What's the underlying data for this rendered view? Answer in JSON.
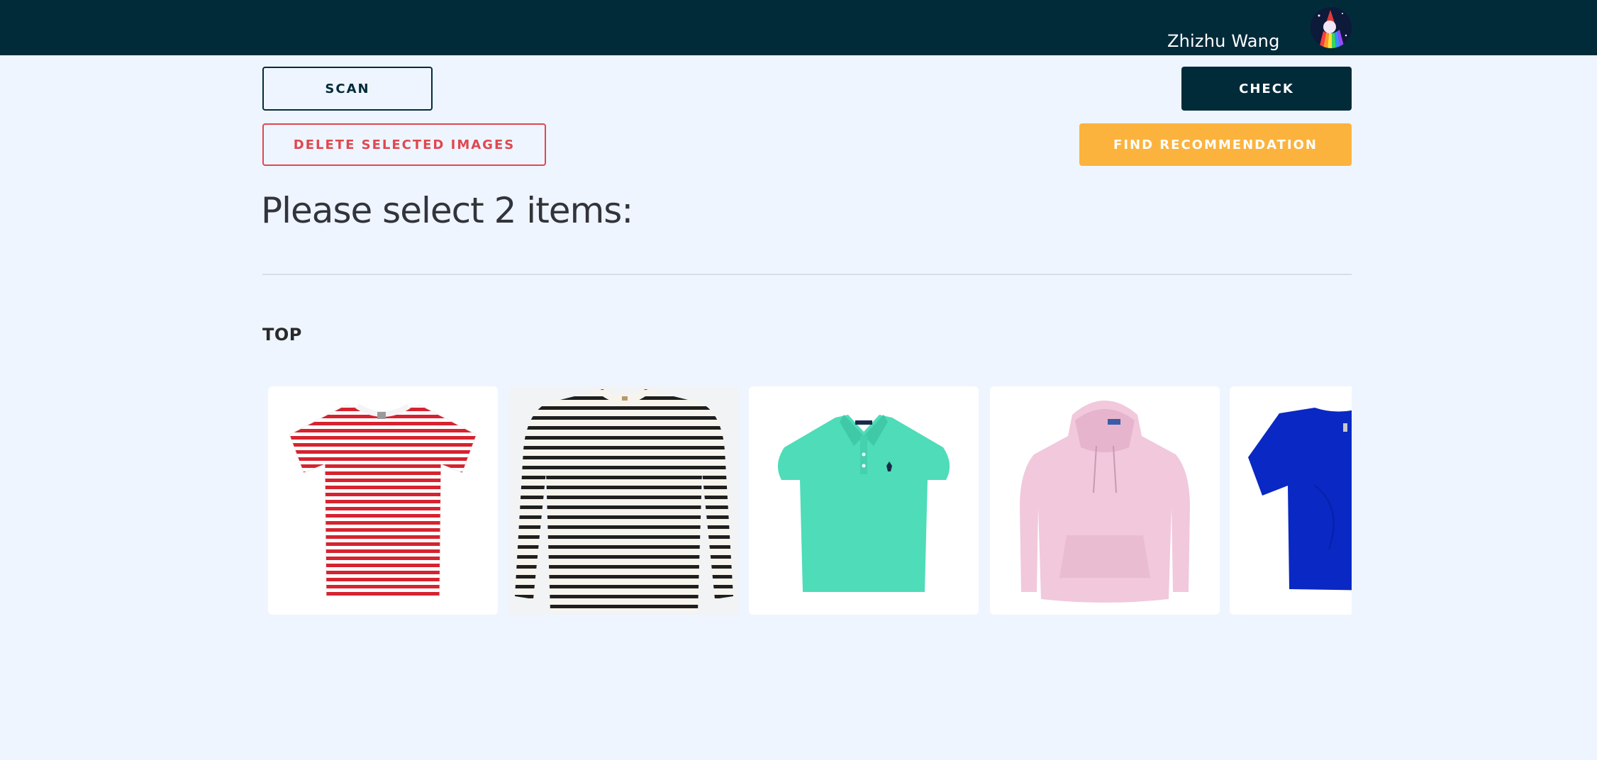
{
  "navbar": {
    "username": "Zhizhu Wang",
    "avatar_icon": "avatar-rainbow-icon"
  },
  "actions": {
    "scan_label": "SCAN",
    "check_label": "CHECK",
    "delete_label": "DELETE SELECTED IMAGES",
    "find_label": "FIND RECOMMENDATION"
  },
  "colors": {
    "navbar": "#022b3a",
    "background": "#eef5fe",
    "danger": "#e0474f",
    "accent": "#fbb33e"
  },
  "main": {
    "heading": "Please select 2 items:",
    "category": "TOP",
    "items": [
      {
        "name": "red-striped-tshirt",
        "color": "#d6232f"
      },
      {
        "name": "black-striped-longsleeve",
        "color": "#1f1f1f"
      },
      {
        "name": "mint-polo-shirt",
        "color": "#4fdcb8"
      },
      {
        "name": "pink-hoodie",
        "color": "#f1c8dc"
      },
      {
        "name": "blue-tshirt",
        "color": "#0a28c4"
      }
    ]
  }
}
